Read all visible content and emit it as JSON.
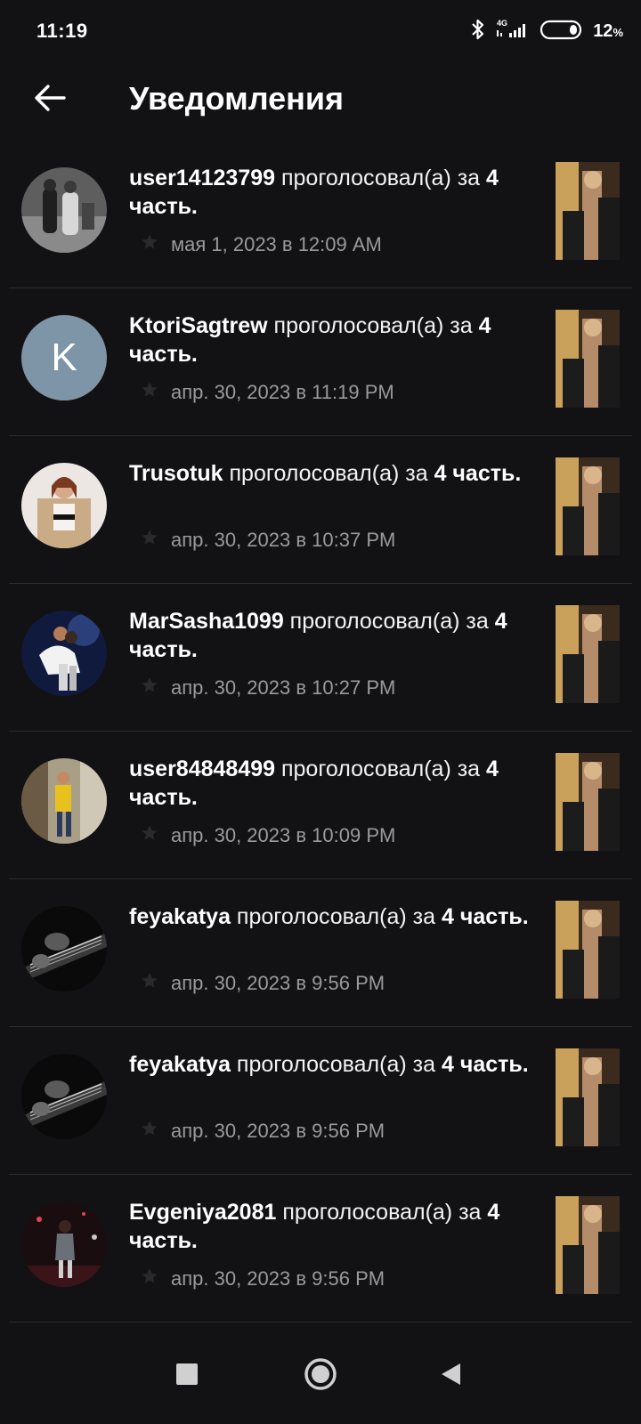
{
  "status_bar": {
    "time": "11:19",
    "network": "4G",
    "battery_percent": "12",
    "battery_unit": "%"
  },
  "header": {
    "title": "Уведомления",
    "back_icon": "arrow-left-icon"
  },
  "notifications": [
    {
      "user": "user14123799",
      "action": " проголосовал(а) за ",
      "part": "4 часть.",
      "time": "мая 1, 2023 в 12:09 AM",
      "avatar": "photo"
    },
    {
      "user": "KtoriSagtrew",
      "action": " проголосовал(а) за ",
      "part": "4 часть.",
      "time": "апр. 30, 2023 в 11:19 PM",
      "avatar": "letter",
      "avatar_letter": "K"
    },
    {
      "user": "Trusotuk",
      "action": " проголосовал(а) за ",
      "part": "4 часть.",
      "time": "апр. 30, 2023 в 10:37 PM",
      "avatar": "photo"
    },
    {
      "user": "MarSasha1099",
      "action": " проголосовал(а) за ",
      "part": "4 часть.",
      "time": "апр. 30, 2023 в 10:27 PM",
      "avatar": "photo"
    },
    {
      "user": "user84848499",
      "action": " проголосовал(а) за ",
      "part": "4 часть.",
      "time": "апр. 30, 2023 в 10:09 PM",
      "avatar": "photo"
    },
    {
      "user": "feyakatya",
      "action": " проголосовал(а) за ",
      "part": "4 часть.",
      "time": "апр. 30, 2023 в 9:56 PM",
      "avatar": "photo"
    },
    {
      "user": "feyakatya",
      "action": " проголосовал(а) за ",
      "part": "4 часть.",
      "time": "апр. 30, 2023 в 9:56 PM",
      "avatar": "photo"
    },
    {
      "user": "Evgeniya2081",
      "action": " проголосовал(а) за ",
      "part": "4 часть.",
      "time": "апр. 30, 2023 в 9:56 PM",
      "avatar": "photo"
    }
  ],
  "nav_bar": {
    "recents_icon": "square-icon",
    "home_icon": "circle-icon",
    "back_icon": "triangle-back-icon"
  },
  "colors": {
    "background": "#121114",
    "divider": "#2c2b30",
    "meta_text": "#9a9a9e",
    "letter_avatar": "#7e95a7"
  }
}
